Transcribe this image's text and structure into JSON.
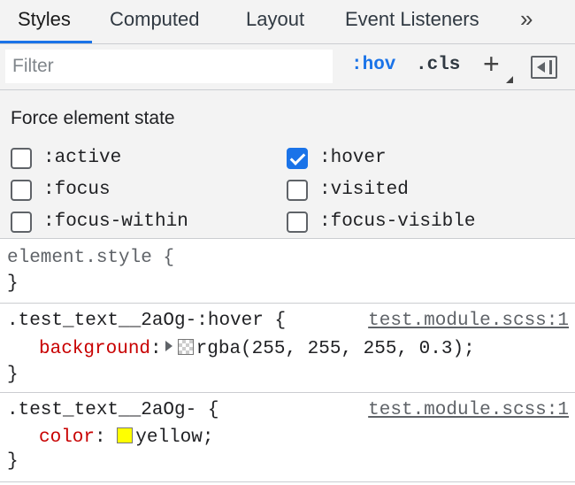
{
  "tabs": [
    {
      "label": "Styles",
      "active": true
    },
    {
      "label": "Computed",
      "active": false
    },
    {
      "label": "Layout",
      "active": false
    },
    {
      "label": "Event Listeners",
      "active": false
    }
  ],
  "tab_more_label": "»",
  "toolbar": {
    "filter_placeholder": "Filter",
    "filter_value": "",
    "hov_label": ":hov",
    "cls_label": ".cls",
    "add_label": "+",
    "accent_color": "#1a73e8"
  },
  "force_state": {
    "title": "Force element state",
    "states": [
      {
        "label": ":active",
        "checked": false
      },
      {
        "label": ":hover",
        "checked": true
      },
      {
        "label": ":focus",
        "checked": false
      },
      {
        "label": ":visited",
        "checked": false
      },
      {
        "label": ":focus-within",
        "checked": false
      },
      {
        "label": ":focus-visible",
        "checked": false
      }
    ]
  },
  "rules": [
    {
      "selector": "element.style {",
      "source": "",
      "declarations": [],
      "close": "}"
    },
    {
      "selector": ".test_text__2aOg-:hover {",
      "source": "test.module.scss:1",
      "declarations": [
        {
          "property": "background",
          "colon": ":",
          "value": "rgba(255, 255, 255, 0.3);",
          "swatch_color": "rgba(255, 255, 255, 0.3)"
        }
      ],
      "close": "}"
    },
    {
      "selector": ".test_text__2aOg- {",
      "source": "test.module.scss:1",
      "declarations": [
        {
          "property": "color",
          "colon": ": ",
          "value": "yellow;",
          "swatch_color": "#ffff00"
        }
      ],
      "close": "}"
    }
  ],
  "colors": {
    "property_name": "#c80000",
    "active_tab_underline": "#1a73e8"
  }
}
